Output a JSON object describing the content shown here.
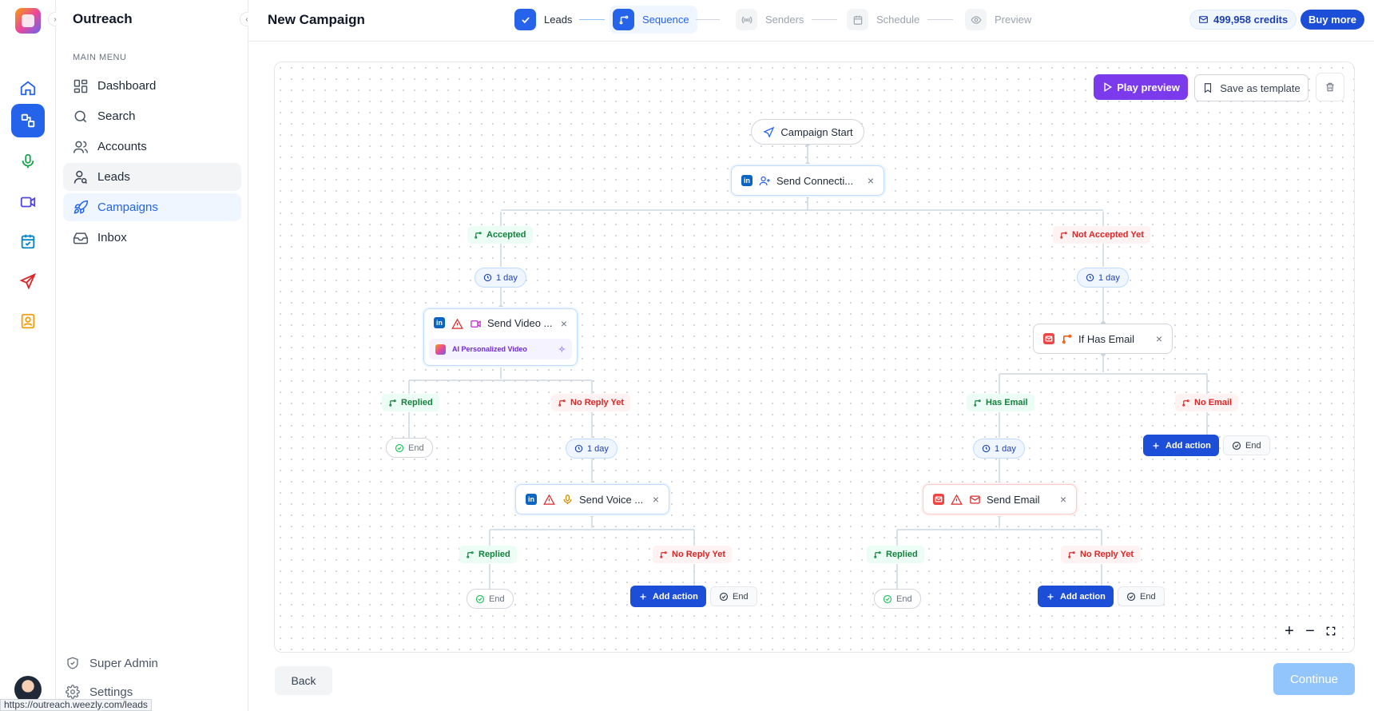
{
  "app": {
    "name": "Outreach"
  },
  "sidebar": {
    "section_label": "MAIN MENU",
    "items": [
      {
        "label": "Dashboard",
        "icon": "dashboard-icon"
      },
      {
        "label": "Search",
        "icon": "search-icon"
      },
      {
        "label": "Accounts",
        "icon": "users-icon"
      },
      {
        "label": "Leads",
        "icon": "user-search-icon"
      },
      {
        "label": "Campaigns",
        "icon": "rocket-icon"
      },
      {
        "label": "Inbox",
        "icon": "inbox-icon"
      }
    ],
    "bottom": [
      {
        "label": "Super Admin",
        "icon": "shield-icon"
      },
      {
        "label": "Settings",
        "icon": "gear-icon"
      }
    ]
  },
  "header": {
    "title": "New Campaign",
    "steps": [
      {
        "label": "Leads",
        "state": "done"
      },
      {
        "label": "Sequence",
        "state": "current"
      },
      {
        "label": "Senders",
        "state": "upcoming"
      },
      {
        "label": "Schedule",
        "state": "upcoming"
      },
      {
        "label": "Preview",
        "state": "upcoming"
      }
    ],
    "credits": "499,958 credits",
    "buy_more": "Buy more"
  },
  "toolbar": {
    "play_preview": "Play preview",
    "save_template": "Save as template"
  },
  "flow": {
    "start": "Campaign Start",
    "send_connection": "Send Connecti...",
    "accepted": "Accepted",
    "not_accepted": "Not Accepted Yet",
    "delay_1day": "1 day",
    "send_video": "Send Video ...",
    "ai_video": "AI Personalized Video",
    "if_has_email": "If Has Email",
    "replied": "Replied",
    "no_reply_yet": "No Reply Yet",
    "has_email": "Has Email",
    "no_email": "No Email",
    "end": "End",
    "add_action": "Add action",
    "send_voice": "Send Voice ...",
    "send_email": "Send Email",
    "close": "×"
  },
  "footer": {
    "back": "Back",
    "continue": "Continue"
  },
  "status_bar_url": "https://outreach.weezly.com/leads",
  "colors": {
    "primary": "#2563eb",
    "purple": "#7c3aed",
    "green": "#15803d",
    "red": "#dc2626"
  }
}
